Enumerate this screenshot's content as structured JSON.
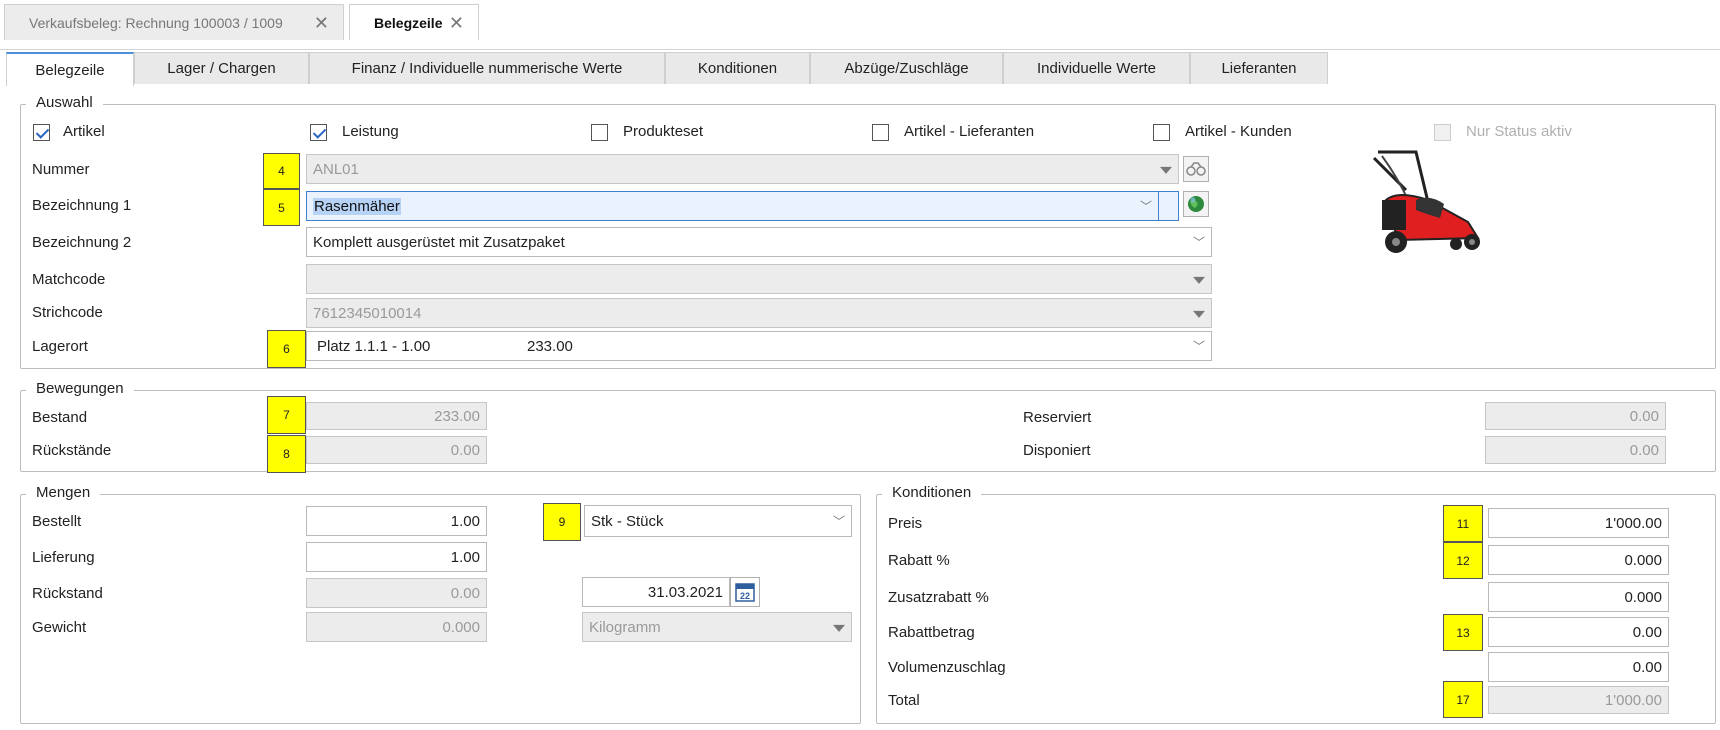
{
  "doc_tabs": [
    {
      "label": "Verkaufsbeleg: Rechnung 100003 / 1009",
      "close": "✕"
    },
    {
      "label": "Belegzeile",
      "close": "✕"
    }
  ],
  "sub_tabs": [
    "Belegzeile",
    "Lager / Chargen",
    "Finanz / Individuelle nummerische Werte",
    "Konditionen",
    "Abzüge/Zuschläge",
    "Individuelle Werte",
    "Lieferanten"
  ],
  "auswahl": {
    "title": "Auswahl",
    "checkboxes": [
      {
        "label": "Artikel",
        "checked": true
      },
      {
        "label": "Leistung",
        "checked": true
      },
      {
        "label": "Produkteset",
        "checked": false
      },
      {
        "label": "Artikel - Lieferanten",
        "checked": false
      },
      {
        "label": "Artikel - Kunden",
        "checked": false
      },
      {
        "label": "Nur Status aktiv",
        "checked": false,
        "disabled": true
      }
    ],
    "nummer_label": "Nummer",
    "nummer_value": "ANL01",
    "bez1_label": "Bezeichnung 1",
    "bez1_value": "Rasenmäher",
    "bez2_label": "Bezeichnung 2",
    "bez2_value": "Komplett ausgerüstet mit Zusatzpaket",
    "matchcode_label": "Matchcode",
    "matchcode_value": "",
    "strichcode_label": "Strichcode",
    "strichcode_value": "7612345010014",
    "lagerort_label": "Lagerort",
    "lagerort_value": "Platz 1.1.1 - 1.00",
    "lagerort_qty": "233.00"
  },
  "bewegungen": {
    "title": "Bewegungen",
    "bestand_label": "Bestand",
    "bestand_value": "233.00",
    "rueck_label": "Rückstände",
    "rueck_value": "0.00",
    "reserviert_label": "Reserviert",
    "reserviert_value": "0.00",
    "disponiert_label": "Disponiert",
    "disponiert_value": "0.00"
  },
  "mengen": {
    "title": "Mengen",
    "bestellt_label": "Bestellt",
    "bestellt_value": "1.00",
    "lieferung_label": "Lieferung",
    "lieferung_value": "1.00",
    "rueckstand_label": "Rückstand",
    "rueckstand_value": "0.00",
    "gewicht_label": "Gewicht",
    "gewicht_value": "0.000",
    "einheit_value": "Stk - Stück",
    "datum_value": "31.03.2021",
    "calendar_day": "22",
    "gewicht_einheit": "Kilogramm"
  },
  "konditionen": {
    "title": "Konditionen",
    "preis_label": "Preis",
    "preis_value": "1'000.00",
    "rabatt_label": "Rabatt %",
    "rabatt_value": "0.000",
    "zusatz_label": "Zusatzrabatt %",
    "zusatz_value": "0.000",
    "rabattbetrag_label": "Rabattbetrag",
    "rabattbetrag_value": "0.00",
    "volumen_label": "Volumenzuschlag",
    "volumen_value": "0.00",
    "total_label": "Total",
    "total_value": "1'000.00"
  },
  "badges": [
    "4",
    "5",
    "6",
    "7",
    "8",
    "9",
    "11",
    "12",
    "13",
    "17"
  ],
  "colors": {
    "badge": "#ffff00",
    "accent": "#2a66c0",
    "readonly": "#ececec"
  }
}
